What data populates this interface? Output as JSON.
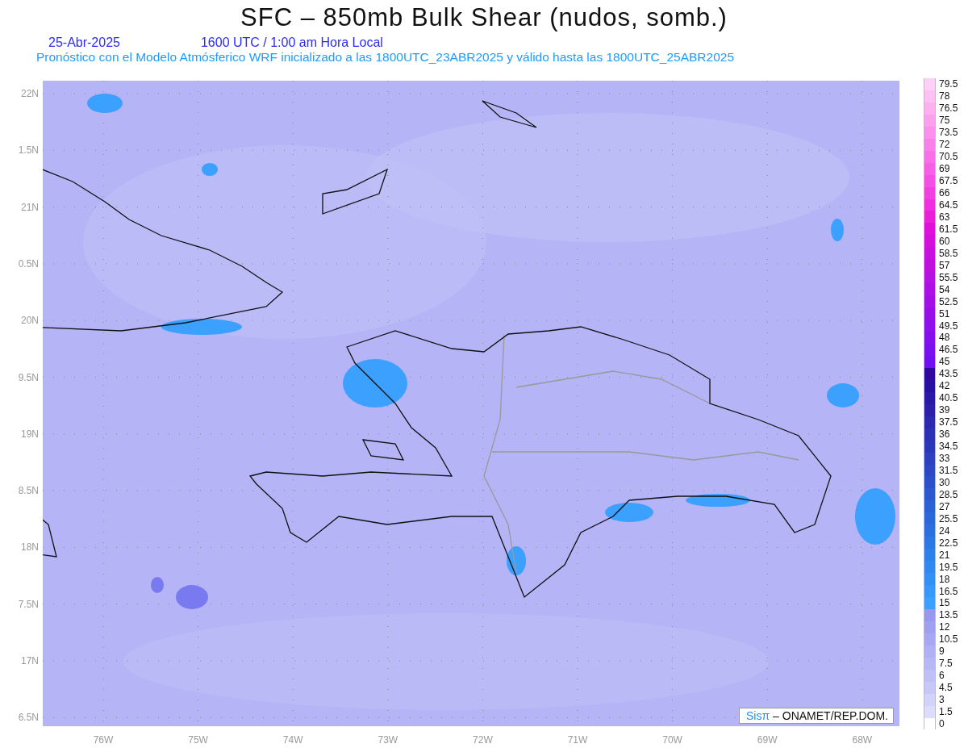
{
  "title": "SFC – 850mb Bulk Shear (nudos, somb.)",
  "date": "25-Abr-2025",
  "time": "1600 UTC / 1:00 am Hora Local",
  "subtitle": "Pronóstico con el Modelo Atmósferico WRF inicializado a las 1800UTC_23ABR2025 y válido hasta las  1800UTC_25ABR2025",
  "lat_labels": [
    "22N",
    "1.5N",
    "21N",
    "0.5N",
    "20N",
    "9.5N",
    "19N",
    "8.5N",
    "18N",
    "7.5N",
    "17N",
    "6.5N"
  ],
  "lon_labels": [
    "76W",
    "75W",
    "74W",
    "73W",
    "72W",
    "71W",
    "70W",
    "69W",
    "68W"
  ],
  "credit": {
    "logo": "Sisπ",
    "text": "– ONAMET/REP.DOM."
  },
  "legend": [
    {
      "label": "79.5",
      "color": "#fed0f8"
    },
    {
      "label": "78",
      "color": "#fcc0f4"
    },
    {
      "label": "76.5",
      "color": "#fcb0f0"
    },
    {
      "label": "75",
      "color": "#faa0ee"
    },
    {
      "label": "73.5",
      "color": "#fa90ec"
    },
    {
      "label": "72",
      "color": "#f880ea"
    },
    {
      "label": "70.5",
      "color": "#f870e8"
    },
    {
      "label": "69",
      "color": "#f660e6"
    },
    {
      "label": "67.5",
      "color": "#f450e4"
    },
    {
      "label": "66",
      "color": "#f040e0"
    },
    {
      "label": "64.5",
      "color": "#f030e0"
    },
    {
      "label": "63",
      "color": "#e820d8"
    },
    {
      "label": "61.5",
      "color": "#de10da"
    },
    {
      "label": "60",
      "color": "#d410dc"
    },
    {
      "label": "58.5",
      "color": "#ca10de"
    },
    {
      "label": "57",
      "color": "#c010e0"
    },
    {
      "label": "55.5",
      "color": "#b610e2"
    },
    {
      "label": "54",
      "color": "#ac10e4"
    },
    {
      "label": "52.5",
      "color": "#a210e6"
    },
    {
      "label": "51",
      "color": "#9810e8"
    },
    {
      "label": "49.5",
      "color": "#8e10ea"
    },
    {
      "label": "48",
      "color": "#8410ec"
    },
    {
      "label": "46.5",
      "color": "#7a10ee"
    },
    {
      "label": "45",
      "color": "#7010f0"
    },
    {
      "label": "43.5",
      "color": "#3008a0"
    },
    {
      "label": "42",
      "color": "#2810a0"
    },
    {
      "label": "40.5",
      "color": "#2a18a8"
    },
    {
      "label": "39",
      "color": "#2c20aa"
    },
    {
      "label": "37.5",
      "color": "#2c28b0"
    },
    {
      "label": "36",
      "color": "#2c30b5"
    },
    {
      "label": "34.5",
      "color": "#2c38ba"
    },
    {
      "label": "33",
      "color": "#2c40c0"
    },
    {
      "label": "31.5",
      "color": "#2c48c5"
    },
    {
      "label": "30",
      "color": "#2c50ca"
    },
    {
      "label": "28.5",
      "color": "#2c58d0"
    },
    {
      "label": "27",
      "color": "#2c60d5"
    },
    {
      "label": "25.5",
      "color": "#2c68da"
    },
    {
      "label": "24",
      "color": "#2c70e0"
    },
    {
      "label": "22.5",
      "color": "#2c78e5"
    },
    {
      "label": "21",
      "color": "#2e80ea"
    },
    {
      "label": "19.5",
      "color": "#3088f0"
    },
    {
      "label": "18",
      "color": "#3490f5"
    },
    {
      "label": "16.5",
      "color": "#3898fa"
    },
    {
      "label": "15",
      "color": "#3ca0ff"
    },
    {
      "label": "13.5",
      "color": "#9898ee"
    },
    {
      "label": "12",
      "color": "#a0a0f0"
    },
    {
      "label": "10.5",
      "color": "#a8a8f2"
    },
    {
      "label": "9",
      "color": "#b0b0f5"
    },
    {
      "label": "7.5",
      "color": "#b8b8f5"
    },
    {
      "label": "6",
      "color": "#c0c0f8"
    },
    {
      "label": "4.5",
      "color": "#c8c8f8"
    },
    {
      "label": "3",
      "color": "#d2d2fa"
    },
    {
      "label": "1.5",
      "color": "#dcdcfc"
    },
    {
      "label": "0",
      "color": "#ffffff"
    }
  ]
}
